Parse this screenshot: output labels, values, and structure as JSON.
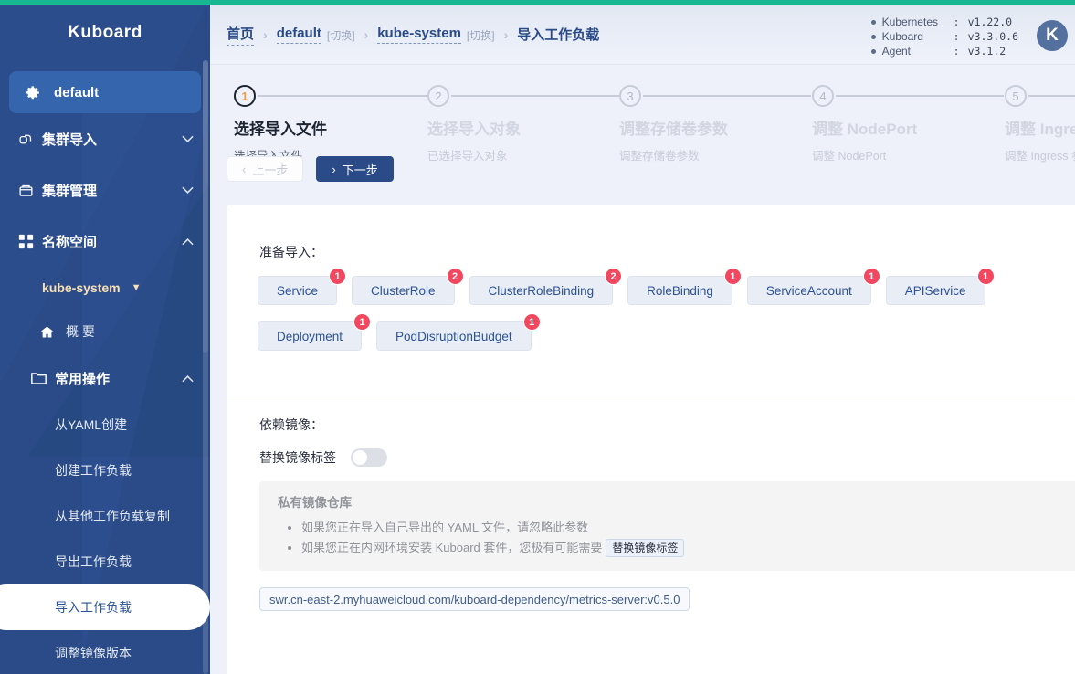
{
  "brand": "Kuboard",
  "sidebar": {
    "namespace_pill": {
      "label": "default",
      "icon": "gear-icon"
    },
    "groups": [
      {
        "label": "集群导入",
        "icon": "link-icon",
        "chevron": "⌄"
      },
      {
        "label": "集群管理",
        "icon": "box-icon",
        "chevron": "⌄"
      },
      {
        "label": "名称空间",
        "icon": "grid-icon",
        "chevron": "⌃"
      }
    ],
    "namespace_select": {
      "label": "kube-system",
      "caret": "▼"
    },
    "overview": {
      "label": "概 要",
      "icon": "home-icon"
    },
    "ops_group": {
      "label": "常用操作",
      "icon": "folder-icon",
      "chevron": "⌃"
    },
    "ops_items": [
      {
        "label": "从YAML创建",
        "active": false
      },
      {
        "label": "创建工作负载",
        "active": false
      },
      {
        "label": "从其他工作负载复制",
        "active": false
      },
      {
        "label": "导出工作负载",
        "active": false
      },
      {
        "label": "导入工作负载",
        "active": true
      },
      {
        "label": "调整镜像版本",
        "active": false
      }
    ]
  },
  "header": {
    "breadcrumb": [
      {
        "text": "首页",
        "switch": "",
        "link": true
      },
      {
        "text": "default",
        "switch": "[切换]",
        "link": true
      },
      {
        "text": "kube-system",
        "switch": "[切换]",
        "link": true
      },
      {
        "text": "导入工作负载",
        "switch": "",
        "link": false
      }
    ],
    "separator": "›",
    "versions": [
      {
        "name": "Kubernetes",
        "colon": ":",
        "value": "v1.22.0"
      },
      {
        "name": "Kuboard",
        "colon": ":",
        "value": "v3.3.0.6"
      },
      {
        "name": "Agent",
        "colon": ":",
        "value": "v3.1.2"
      }
    ],
    "avatar": "K"
  },
  "steps": [
    {
      "num": "1",
      "title": "选择导入文件",
      "desc": "选择导入文件",
      "active": true
    },
    {
      "num": "2",
      "title": "选择导入对象",
      "desc": "已选择导入对象",
      "active": false
    },
    {
      "num": "3",
      "title": "调整存储卷参数",
      "desc": "调整存储卷参数",
      "active": false
    },
    {
      "num": "4",
      "title": "调整 NodePort",
      "desc": "调整 NodePort",
      "active": false
    },
    {
      "num": "5",
      "title": "调整 Ingress",
      "desc": "调整 Ingress 参数",
      "active": false
    }
  ],
  "step_buttons": {
    "prev": {
      "label": "上一步",
      "icon": "chevron-left-icon",
      "glyph": "‹"
    },
    "next": {
      "label": "下一步",
      "icon": "chevron-right-icon",
      "glyph": "›"
    }
  },
  "content": {
    "prepare_label": "准备导入：",
    "resources": [
      {
        "name": "Service",
        "count": "1"
      },
      {
        "name": "ClusterRole",
        "count": "2"
      },
      {
        "name": "ClusterRoleBinding",
        "count": "2"
      },
      {
        "name": "RoleBinding",
        "count": "1"
      },
      {
        "name": "ServiceAccount",
        "count": "1"
      },
      {
        "name": "APIService",
        "count": "1"
      },
      {
        "name": "Deployment",
        "count": "1"
      },
      {
        "name": "PodDisruptionBudget",
        "count": "1"
      }
    ],
    "dependency_label": "依赖镜像：",
    "switch_label": "替换镜像标签",
    "switch_on": false,
    "notice": {
      "title": "私有镜像仓库",
      "lines": [
        {
          "text": "如果您正在导入自己导出的 YAML 文件，请忽略此参数",
          "chip": ""
        },
        {
          "text": "如果您正在内网环境安装 Kuboard 套件，您极有可能需要",
          "chip": "替换镜像标签"
        }
      ]
    },
    "images": [
      "swr.cn-east-2.myhuaweicloud.com/kuboard-dependency/metrics-server:v0.5.0"
    ]
  },
  "colors": {
    "accent_green": "#17b891",
    "sidebar_blue": "#2a4b87",
    "primary_blue": "#2a4b87",
    "badge_red": "#f1485f",
    "link_blue": "#2a5298",
    "step_active_num": "#e8a33d"
  }
}
